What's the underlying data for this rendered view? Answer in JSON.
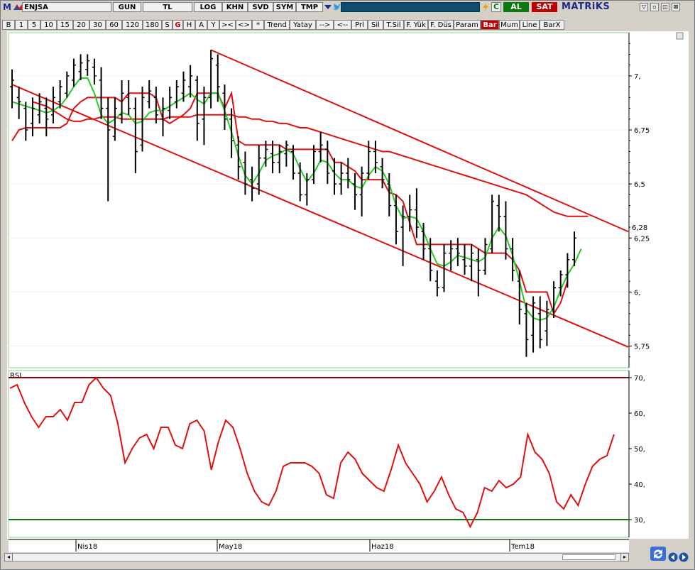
{
  "toolbar": {
    "logo": "M",
    "symbol": "ENJSA",
    "row1": [
      "GUN",
      "TL",
      "LOG",
      "KHN",
      "SVD",
      "SYM",
      "TMP"
    ],
    "buy_label": "AL",
    "sell_label": "SAT",
    "brand": "MATRiKS",
    "row2": [
      "B",
      "1",
      "5",
      "10",
      "15",
      "20",
      "30",
      "60",
      "120",
      "180",
      "S",
      "G",
      "H",
      "A",
      "Y",
      "><",
      "<>",
      "*",
      "Trend",
      "Yatay",
      "-->",
      "<--",
      "Prl",
      "Sil",
      "T.Sil",
      "F. Yük",
      "F. Düs",
      "Param",
      "Bar",
      "Mum",
      "Line",
      "BarX"
    ]
  },
  "colors": {
    "price_bar": "#000000",
    "ma_green": "#22cc22",
    "envelope_red": "#dd1111",
    "trend_red": "#e01010",
    "rsi_line": "#e01010",
    "rsi_upper": "#8b0000",
    "rsi_lower": "#0a7a0a"
  },
  "chart_data": [
    {
      "type": "bar",
      "description_of_marks": "OHLC price bars",
      "x": [
        "2018-03-19",
        "2018-03-20",
        "2018-03-21",
        "2018-03-22",
        "2018-03-23",
        "2018-03-26",
        "2018-03-27",
        "2018-03-28",
        "2018-03-29",
        "2018-03-30",
        "2018-04-02",
        "2018-04-03",
        "2018-04-04",
        "2018-04-05",
        "2018-04-06",
        "2018-04-09",
        "2018-04-10",
        "2018-04-11",
        "2018-04-12",
        "2018-04-13",
        "2018-04-16",
        "2018-04-17",
        "2018-04-18",
        "2018-04-19",
        "2018-04-20",
        "2018-04-24",
        "2018-04-25",
        "2018-04-26",
        "2018-04-27",
        "2018-04-30",
        "2018-05-02",
        "2018-05-03",
        "2018-05-04",
        "2018-05-07",
        "2018-05-08",
        "2018-05-09",
        "2018-05-10",
        "2018-05-11",
        "2018-05-14",
        "2018-05-15",
        "2018-05-16",
        "2018-05-17",
        "2018-05-18",
        "2018-05-21",
        "2018-05-22",
        "2018-05-23",
        "2018-05-24",
        "2018-05-25",
        "2018-05-28",
        "2018-05-29",
        "2018-05-30",
        "2018-05-31",
        "2018-06-01",
        "2018-06-04",
        "2018-06-05",
        "2018-06-06",
        "2018-06-07",
        "2018-06-08",
        "2018-06-11",
        "2018-06-12",
        "2018-06-13",
        "2018-06-14",
        "2018-06-18",
        "2018-06-19",
        "2018-06-20",
        "2018-06-21",
        "2018-06-22",
        "2018-06-25",
        "2018-06-26",
        "2018-06-27",
        "2018-06-28",
        "2018-06-29",
        "2018-07-02",
        "2018-07-03",
        "2018-07-04",
        "2018-07-05",
        "2018-07-06",
        "2018-07-09",
        "2018-07-10",
        "2018-07-11",
        "2018-07-12",
        "2018-07-13",
        "2018-07-16",
        "2018-07-17",
        "2018-07-18",
        "2018-07-19",
        "2018-07-20",
        "2018-07-23",
        "2018-07-24"
      ],
      "ohlc": [
        [
          6.95,
          7.03,
          6.85,
          6.98
        ],
        [
          6.9,
          6.95,
          6.8,
          6.88
        ],
        [
          6.85,
          6.88,
          6.7,
          6.75
        ],
        [
          6.78,
          6.9,
          6.72,
          6.85
        ],
        [
          6.82,
          6.92,
          6.78,
          6.88
        ],
        [
          6.85,
          6.9,
          6.72,
          6.8
        ],
        [
          6.82,
          6.95,
          6.78,
          6.9
        ],
        [
          6.88,
          6.98,
          6.85,
          6.95
        ],
        [
          6.92,
          7.02,
          6.9,
          7.0
        ],
        [
          6.98,
          7.08,
          6.95,
          7.05
        ],
        [
          7.02,
          7.1,
          6.98,
          7.06
        ],
        [
          7.03,
          7.1,
          7.0,
          7.07
        ],
        [
          7.04,
          7.08,
          6.96,
          7.0
        ],
        [
          6.98,
          7.04,
          6.8,
          6.85
        ],
        [
          6.85,
          6.9,
          6.42,
          6.75
        ],
        [
          6.72,
          6.9,
          6.7,
          6.85
        ],
        [
          6.82,
          6.98,
          6.78,
          6.92
        ],
        [
          6.9,
          6.98,
          6.82,
          6.85
        ],
        [
          6.85,
          6.9,
          6.55,
          6.65
        ],
        [
          6.68,
          6.95,
          6.65,
          6.9
        ],
        [
          6.88,
          6.98,
          6.85,
          6.93
        ],
        [
          6.9,
          6.95,
          6.78,
          6.82
        ],
        [
          6.8,
          6.9,
          6.72,
          6.85
        ],
        [
          6.84,
          6.95,
          6.8,
          6.9
        ],
        [
          6.88,
          6.98,
          6.85,
          6.95
        ],
        [
          6.92,
          7.02,
          6.88,
          6.98
        ],
        [
          6.95,
          7.05,
          6.9,
          7.0
        ],
        [
          6.98,
          7.0,
          6.7,
          6.78
        ],
        [
          6.8,
          6.95,
          6.68,
          6.9
        ],
        [
          6.9,
          7.12,
          6.85,
          7.08
        ],
        [
          7.05,
          7.1,
          6.88,
          6.95
        ],
        [
          6.92,
          6.96,
          6.75,
          6.8
        ],
        [
          6.8,
          6.85,
          6.62,
          6.7
        ],
        [
          6.68,
          6.72,
          6.52,
          6.58
        ],
        [
          6.6,
          6.65,
          6.45,
          6.5
        ],
        [
          6.52,
          6.58,
          6.42,
          6.48
        ],
        [
          6.5,
          6.68,
          6.45,
          6.62
        ],
        [
          6.62,
          6.7,
          6.58,
          6.66
        ],
        [
          6.64,
          6.7,
          6.55,
          6.6
        ],
        [
          6.6,
          6.68,
          6.55,
          6.65
        ],
        [
          6.64,
          6.7,
          6.58,
          6.68
        ],
        [
          6.65,
          6.68,
          6.52,
          6.55
        ],
        [
          6.55,
          6.6,
          6.42,
          6.45
        ],
        [
          6.45,
          6.55,
          6.4,
          6.52
        ],
        [
          6.52,
          6.68,
          6.5,
          6.65
        ],
        [
          6.65,
          6.74,
          6.6,
          6.68
        ],
        [
          6.66,
          6.7,
          6.5,
          6.55
        ],
        [
          6.56,
          6.62,
          6.45,
          6.5
        ],
        [
          6.5,
          6.6,
          6.45,
          6.55
        ],
        [
          6.55,
          6.62,
          6.48,
          6.52
        ],
        [
          6.5,
          6.55,
          6.38,
          6.45
        ],
        [
          6.45,
          6.58,
          6.35,
          6.55
        ],
        [
          6.55,
          6.7,
          6.52,
          6.65
        ],
        [
          6.65,
          6.7,
          6.55,
          6.6
        ],
        [
          6.58,
          6.62,
          6.48,
          6.52
        ],
        [
          6.5,
          6.55,
          6.35,
          6.4
        ],
        [
          6.4,
          6.45,
          6.22,
          6.28
        ],
        [
          6.3,
          6.4,
          6.12,
          6.35
        ],
        [
          6.35,
          6.45,
          6.28,
          6.38
        ],
        [
          6.38,
          6.48,
          6.25,
          6.3
        ],
        [
          6.28,
          6.32,
          6.15,
          6.2
        ],
        [
          6.2,
          6.25,
          6.05,
          6.1
        ],
        [
          6.05,
          6.1,
          5.98,
          6.02
        ],
        [
          6.02,
          6.22,
          6.0,
          6.18
        ],
        [
          6.18,
          6.24,
          6.1,
          6.2
        ],
        [
          6.2,
          6.25,
          6.12,
          6.18
        ],
        [
          6.15,
          6.22,
          6.08,
          6.12
        ],
        [
          6.12,
          6.22,
          6.05,
          6.18
        ],
        [
          6.15,
          6.2,
          5.98,
          6.1
        ],
        [
          6.1,
          6.25,
          6.08,
          6.22
        ],
        [
          6.2,
          6.45,
          6.18,
          6.42
        ],
        [
          6.4,
          6.45,
          6.28,
          6.35
        ],
        [
          6.35,
          6.42,
          6.15,
          6.2
        ],
        [
          6.2,
          6.25,
          6.05,
          6.1
        ],
        [
          6.05,
          6.1,
          5.85,
          5.92
        ],
        [
          5.9,
          5.95,
          5.7,
          5.78
        ],
        [
          5.8,
          5.98,
          5.72,
          5.95
        ],
        [
          5.9,
          5.98,
          5.74,
          5.78
        ],
        [
          5.82,
          5.96,
          5.75,
          5.92
        ],
        [
          5.92,
          6.05,
          5.88,
          6.02
        ],
        [
          6.02,
          6.1,
          5.98,
          6.08
        ],
        [
          6.08,
          6.18,
          6.02,
          6.15
        ],
        [
          6.15,
          6.28,
          6.12,
          6.25
        ]
      ],
      "ma_green": [
        6.88,
        6.87,
        6.86,
        6.85,
        6.84,
        6.83,
        6.84,
        6.86,
        6.9,
        6.95,
        6.99,
        6.99,
        6.92,
        6.82,
        6.78,
        6.8,
        6.83,
        6.82,
        6.78,
        6.79,
        6.83,
        6.84,
        6.84,
        6.86,
        6.88,
        6.9,
        6.92,
        6.89,
        6.87,
        6.92,
        6.92,
        6.84,
        6.74,
        6.63,
        6.54,
        6.5,
        6.55,
        6.61,
        6.63,
        6.64,
        6.66,
        6.64,
        6.57,
        6.51,
        6.55,
        6.61,
        6.6,
        6.55,
        6.52,
        6.52,
        6.49,
        6.48,
        6.54,
        6.58,
        6.56,
        6.5,
        6.4,
        6.34,
        6.35,
        6.34,
        6.28,
        6.2,
        6.13,
        6.12,
        6.14,
        6.17,
        6.16,
        6.15,
        6.14,
        6.16,
        6.25,
        6.3,
        6.26,
        6.17,
        6.05,
        5.92,
        5.88,
        5.87,
        5.88,
        5.93,
        6.01,
        6.08,
        6.13,
        6.2
      ],
      "envelope_red": [
        6.7,
        6.75,
        6.76,
        6.76,
        6.76,
        6.76,
        6.76,
        6.76,
        6.78,
        6.85,
        6.88,
        6.9,
        6.9,
        6.9,
        6.9,
        6.9,
        6.88,
        6.92,
        6.92,
        6.92,
        6.92,
        6.9,
        6.8,
        6.78,
        6.8,
        6.82,
        6.85,
        6.92,
        6.92,
        6.92,
        6.92,
        6.85,
        6.92,
        6.7,
        6.68,
        6.68,
        6.68,
        6.68,
        6.68,
        6.68,
        6.66,
        6.66,
        6.66,
        6.66,
        6.66,
        6.66,
        6.66,
        6.6,
        6.6,
        6.58,
        6.56,
        6.52,
        6.52,
        6.52,
        6.52,
        6.46,
        6.45,
        6.42,
        6.32,
        6.22,
        6.22,
        6.22,
        6.22,
        6.22,
        6.22,
        6.22,
        6.22,
        6.22,
        6.2,
        6.18,
        6.18,
        6.18,
        6.18,
        6.15,
        6.1,
        6.0,
        6.0,
        6.0,
        6.0,
        5.9,
        5.95,
        6.05
      ],
      "ylim": [
        5.65,
        7.2
      ],
      "yticks": [
        "7,",
        "6,75",
        "6,5",
        "6,25",
        "6,",
        "5,75"
      ],
      "last_price_label": "6,28",
      "trendlines": [
        {
          "x": [
            "2018-03-19",
            "2018-07-24"
          ],
          "y": [
            6.96,
            5.7
          ]
        },
        {
          "x": [
            "2018-04-30",
            "2018-07-24"
          ],
          "y": [
            7.12,
            6.26
          ]
        }
      ]
    },
    {
      "type": "line",
      "title": "RSI",
      "values": [
        67,
        68,
        63,
        59,
        56,
        59,
        59,
        61,
        58,
        63,
        63,
        68,
        70,
        67,
        65,
        57,
        46,
        50,
        53,
        54,
        50,
        56,
        56,
        51,
        50,
        57,
        58,
        55,
        44,
        52,
        58,
        56,
        50,
        43,
        38,
        35,
        34,
        38,
        45,
        46,
        46,
        46,
        45,
        43,
        37,
        36,
        46,
        49,
        47,
        43,
        41,
        39,
        38,
        44,
        51,
        46,
        43,
        40,
        35,
        38,
        42,
        37,
        33,
        32,
        28,
        32,
        39,
        38,
        41,
        39,
        40,
        42,
        54,
        49,
        47,
        43,
        35,
        33,
        37,
        34,
        40,
        45,
        47,
        48,
        54
      ],
      "ylim": [
        25,
        72
      ],
      "yticks": [
        "70,",
        "60,",
        "50,",
        "40,",
        "30,"
      ],
      "levels": [
        70,
        30
      ]
    }
  ],
  "xaxis_labels": [
    "Nis18",
    "May18",
    "Haz18",
    "Tem18"
  ]
}
